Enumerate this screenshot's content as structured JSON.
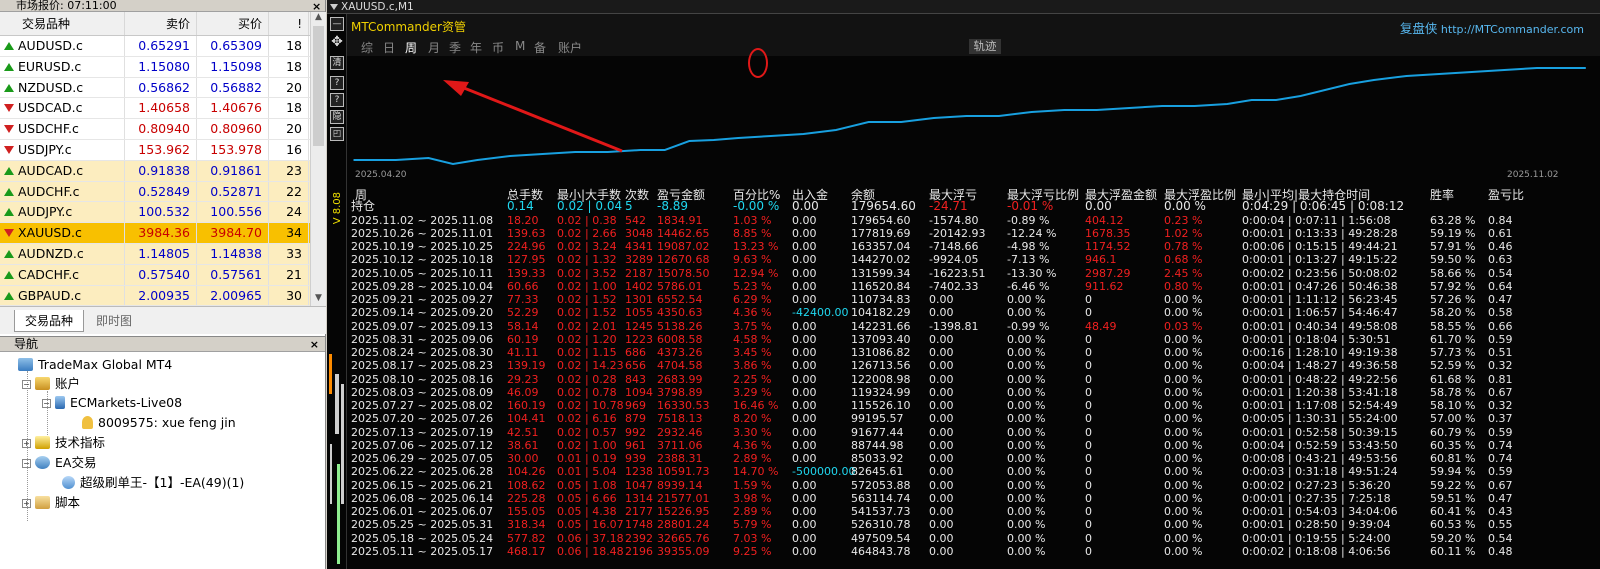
{
  "market_watch": {
    "title": "市场报价: 07:11:00",
    "headers": {
      "symbol": "交易品种",
      "bid": "卖价",
      "ask": "买价",
      "spread": "!"
    },
    "rows": [
      {
        "symbol": "AUDUSD.c",
        "bid": "0.65291",
        "ask": "0.65309",
        "spread": "18",
        "dir": "up",
        "style": ""
      },
      {
        "symbol": "EURUSD.c",
        "bid": "1.15080",
        "ask": "1.15098",
        "spread": "18",
        "dir": "up",
        "style": ""
      },
      {
        "symbol": "NZDUSD.c",
        "bid": "0.56862",
        "ask": "0.56882",
        "spread": "20",
        "dir": "up",
        "style": ""
      },
      {
        "symbol": "USDCAD.c",
        "bid": "1.40658",
        "ask": "1.40676",
        "spread": "18",
        "dir": "dn",
        "style": ""
      },
      {
        "symbol": "USDCHF.c",
        "bid": "0.80940",
        "ask": "0.80960",
        "spread": "20",
        "dir": "dn",
        "style": ""
      },
      {
        "symbol": "USDJPY.c",
        "bid": "153.962",
        "ask": "153.978",
        "spread": "16",
        "dir": "dn",
        "style": ""
      },
      {
        "symbol": "AUDCAD.c",
        "bid": "0.91838",
        "ask": "0.91861",
        "spread": "23",
        "dir": "up",
        "style": "hl"
      },
      {
        "symbol": "AUDCHF.c",
        "bid": "0.52849",
        "ask": "0.52871",
        "spread": "22",
        "dir": "up",
        "style": "hl"
      },
      {
        "symbol": "AUDJPY.c",
        "bid": "100.532",
        "ask": "100.556",
        "spread": "24",
        "dir": "up",
        "style": "hl"
      },
      {
        "symbol": "XAUUSD.c",
        "bid": "3984.36",
        "ask": "3984.70",
        "spread": "34",
        "dir": "dn",
        "style": "sel"
      },
      {
        "symbol": "AUDNZD.c",
        "bid": "1.14805",
        "ask": "1.14838",
        "spread": "33",
        "dir": "up",
        "style": "hl"
      },
      {
        "symbol": "CADCHF.c",
        "bid": "0.57540",
        "ask": "0.57561",
        "spread": "21",
        "dir": "up",
        "style": "hl"
      },
      {
        "symbol": "GBPAUD.c",
        "bid": "2.00935",
        "ask": "2.00965",
        "spread": "30",
        "dir": "up",
        "style": "hl"
      }
    ],
    "tabs": [
      "交易品种",
      "即时图"
    ],
    "close_glyph": "×"
  },
  "navigator": {
    "title": "导航",
    "close_glyph": "×",
    "terminal": "TradeMax Global MT4",
    "accounts": "账户",
    "server": "ECMarkets-Live08",
    "user": "8009575: xue feng jin",
    "indicators": "技术指标",
    "ea": "EA交易",
    "ea_item": "超级刷单王-【1】-EA(49)(1)",
    "scripts": "脚本"
  },
  "chart": {
    "window_title": "XAUUSD.c,M1",
    "side_tools": [
      "—",
      "✥",
      "清",
      "?",
      "?",
      "隐",
      "◰"
    ],
    "side_label": "V 8.08",
    "panel_title": "MTCommander资管",
    "link_cn": "复盘侠",
    "link_url": "http://MTCommander.com",
    "periods": [
      "综",
      "日",
      "周",
      "月",
      "季",
      "年",
      "币",
      "M",
      "备",
      "账户"
    ],
    "active_period": "周",
    "track_button": "轨迹",
    "date_start": "2025.04.20",
    "date_end": "2025.11.02",
    "curve_color": "#18a0e0",
    "annotation_color": "#e01818"
  },
  "table": {
    "headers": [
      "周",
      "总手数",
      "最小|大手数",
      "次数",
      "盈亏金额",
      "百分比%",
      "出入金",
      "余额",
      "最大浮亏",
      "最大浮亏比例",
      "最大浮盈金额",
      "最大浮盈比例",
      "最小|平均|最大持仓时间",
      "胜率",
      "盈亏比"
    ],
    "holding": {
      "label": "持仓",
      "lots": "0.14",
      "minmax": "0.02 | 0.04",
      "count": "5",
      "pnl": "-8.89",
      "pct": "-0.00 %",
      "io": "0.00",
      "balance": "179654.60",
      "maxloss": "-24.71",
      "maxloss_pct": "-0.01 %",
      "maxprofit": "0.00",
      "maxprofit_pct": "0.00 %",
      "time": "0:04:29 | 0:06:45 | 0:08:12",
      "winrate": "",
      "pf": ""
    },
    "rows": [
      {
        "period": "2025.11.02 ~ 2025.11.08",
        "lots": "18.20",
        "minmax": "0.02 | 0.38",
        "count": "542",
        "pnl": "1834.91",
        "pct": "1.03 %",
        "io": "0.00",
        "balance": "179654.60",
        "maxloss": "-1574.80",
        "maxloss_pct": "-0.89 %",
        "maxprofit": "404.12",
        "maxprofit_pct": "0.23 %",
        "time": "0:00:04 | 0:07:11 | 1:56:08",
        "winrate": "63.28 %",
        "pf": "0.84",
        "io_cyan": false
      },
      {
        "period": "2025.10.26 ~ 2025.11.01",
        "lots": "139.63",
        "minmax": "0.02 | 2.66",
        "count": "3048",
        "pnl": "14462.65",
        "pct": "8.85 %",
        "io": "0.00",
        "balance": "177819.69",
        "maxloss": "-20142.93",
        "maxloss_pct": "-12.24 %",
        "maxprofit": "1678.35",
        "maxprofit_pct": "1.02 %",
        "time": "0:00:01 | 0:13:33 | 49:28:28",
        "winrate": "59.19 %",
        "pf": "0.61",
        "io_cyan": false
      },
      {
        "period": "2025.10.19 ~ 2025.10.25",
        "lots": "224.96",
        "minmax": "0.02 | 3.24",
        "count": "4341",
        "pnl": "19087.02",
        "pct": "13.23 %",
        "io": "0.00",
        "balance": "163357.04",
        "maxloss": "-7148.66",
        "maxloss_pct": "-4.98 %",
        "maxprofit": "1174.52",
        "maxprofit_pct": "0.78 %",
        "time": "0:00:06 | 0:15:15 | 49:44:21",
        "winrate": "57.91 %",
        "pf": "0.46",
        "io_cyan": false
      },
      {
        "period": "2025.10.12 ~ 2025.10.18",
        "lots": "127.95",
        "minmax": "0.02 | 1.32",
        "count": "3289",
        "pnl": "12670.68",
        "pct": "9.63 %",
        "io": "0.00",
        "balance": "144270.02",
        "maxloss": "-9924.05",
        "maxloss_pct": "-7.13 %",
        "maxprofit": "946.1",
        "maxprofit_pct": "0.68 %",
        "time": "0:00:01 | 0:13:27 | 49:15:22",
        "winrate": "59.50 %",
        "pf": "0.63",
        "io_cyan": false
      },
      {
        "period": "2025.10.05 ~ 2025.10.11",
        "lots": "139.33",
        "minmax": "0.02 | 3.52",
        "count": "2187",
        "pnl": "15078.50",
        "pct": "12.94 %",
        "io": "0.00",
        "balance": "131599.34",
        "maxloss": "-16223.51",
        "maxloss_pct": "-13.30 %",
        "maxprofit": "2987.29",
        "maxprofit_pct": "2.45 %",
        "time": "0:00:02 | 0:23:56 | 50:08:02",
        "winrate": "58.66 %",
        "pf": "0.54",
        "io_cyan": false
      },
      {
        "period": "2025.09.28 ~ 2025.10.04",
        "lots": "60.66",
        "minmax": "0.02 | 1.00",
        "count": "1402",
        "pnl": "5786.01",
        "pct": "5.23 %",
        "io": "0.00",
        "balance": "116520.84",
        "maxloss": "-7402.33",
        "maxloss_pct": "-6.46 %",
        "maxprofit": "911.62",
        "maxprofit_pct": "0.80 %",
        "time": "0:00:01 | 0:47:26 | 50:46:38",
        "winrate": "57.92 %",
        "pf": "0.64",
        "io_cyan": false
      },
      {
        "period": "2025.09.21 ~ 2025.09.27",
        "lots": "77.33",
        "minmax": "0.02 | 1.52",
        "count": "1301",
        "pnl": "6552.54",
        "pct": "6.29 %",
        "io": "0.00",
        "balance": "110734.83",
        "maxloss": "0.00",
        "maxloss_pct": "0.00 %",
        "maxprofit": "0",
        "maxprofit_pct": "0.00 %",
        "time": "0:00:01 | 1:11:12 | 56:23:45",
        "winrate": "57.26 %",
        "pf": "0.47",
        "io_cyan": false
      },
      {
        "period": "2025.09.14 ~ 2025.09.20",
        "lots": "52.29",
        "minmax": "0.02 | 1.52",
        "count": "1055",
        "pnl": "4350.63",
        "pct": "4.36 %",
        "io": "-42400.00",
        "balance": "104182.29",
        "maxloss": "0.00",
        "maxloss_pct": "0.00 %",
        "maxprofit": "0",
        "maxprofit_pct": "0.00 %",
        "time": "0:00:01 | 1:06:57 | 54:46:47",
        "winrate": "58.20 %",
        "pf": "0.58",
        "io_cyan": true
      },
      {
        "period": "2025.09.07 ~ 2025.09.13",
        "lots": "58.14",
        "minmax": "0.02 | 2.01",
        "count": "1245",
        "pnl": "5138.26",
        "pct": "3.75 %",
        "io": "0.00",
        "balance": "142231.66",
        "maxloss": "-1398.81",
        "maxloss_pct": "-0.99 %",
        "maxprofit": "48.49",
        "maxprofit_pct": "0.03 %",
        "time": "0:00:01 | 0:40:34 | 49:58:08",
        "winrate": "58.55 %",
        "pf": "0.66",
        "io_cyan": false
      },
      {
        "period": "2025.08.31 ~ 2025.09.06",
        "lots": "60.19",
        "minmax": "0.02 | 1.20",
        "count": "1223",
        "pnl": "6008.58",
        "pct": "4.58 %",
        "io": "0.00",
        "balance": "137093.40",
        "maxloss": "0.00",
        "maxloss_pct": "0.00 %",
        "maxprofit": "0",
        "maxprofit_pct": "0.00 %",
        "time": "0:00:01 | 0:18:04 | 5:30:51",
        "winrate": "61.70 %",
        "pf": "0.59",
        "io_cyan": false
      },
      {
        "period": "2025.08.24 ~ 2025.08.30",
        "lots": "41.11",
        "minmax": "0.02 | 1.15",
        "count": "686",
        "pnl": "4373.26",
        "pct": "3.45 %",
        "io": "0.00",
        "balance": "131086.82",
        "maxloss": "0.00",
        "maxloss_pct": "0.00 %",
        "maxprofit": "0",
        "maxprofit_pct": "0.00 %",
        "time": "0:00:16 | 1:28:10 | 49:19:38",
        "winrate": "57.73 %",
        "pf": "0.51",
        "io_cyan": false
      },
      {
        "period": "2025.08.17 ~ 2025.08.23",
        "lots": "139.19",
        "minmax": "0.02 | 14.23",
        "count": "656",
        "pnl": "4704.58",
        "pct": "3.86 %",
        "io": "0.00",
        "balance": "126713.56",
        "maxloss": "0.00",
        "maxloss_pct": "0.00 %",
        "maxprofit": "0",
        "maxprofit_pct": "0.00 %",
        "time": "0:00:04 | 1:48:27 | 49:36:58",
        "winrate": "52.59 %",
        "pf": "0.32",
        "io_cyan": false
      },
      {
        "period": "2025.08.10 ~ 2025.08.16",
        "lots": "29.23",
        "minmax": "0.02 | 0.28",
        "count": "843",
        "pnl": "2683.99",
        "pct": "2.25 %",
        "io": "0.00",
        "balance": "122008.98",
        "maxloss": "0.00",
        "maxloss_pct": "0.00 %",
        "maxprofit": "0",
        "maxprofit_pct": "0.00 %",
        "time": "0:00:01 | 0:48:22 | 49:22:56",
        "winrate": "61.68 %",
        "pf": "0.81",
        "io_cyan": false
      },
      {
        "period": "2025.08.03 ~ 2025.08.09",
        "lots": "46.09",
        "minmax": "0.02 | 0.78",
        "count": "1094",
        "pnl": "3798.89",
        "pct": "3.29 %",
        "io": "0.00",
        "balance": "119324.99",
        "maxloss": "0.00",
        "maxloss_pct": "0.00 %",
        "maxprofit": "0",
        "maxprofit_pct": "0.00 %",
        "time": "0:00:01 | 1:20:38 | 53:41:18",
        "winrate": "58.78 %",
        "pf": "0.67",
        "io_cyan": false
      },
      {
        "period": "2025.07.27 ~ 2025.08.02",
        "lots": "160.19",
        "minmax": "0.02 | 10.78",
        "count": "969",
        "pnl": "16330.53",
        "pct": "16.46 %",
        "io": "0.00",
        "balance": "115526.10",
        "maxloss": "0.00",
        "maxloss_pct": "0.00 %",
        "maxprofit": "0",
        "maxprofit_pct": "0.00 %",
        "time": "0:00:01 | 1:17:08 | 52:54:49",
        "winrate": "58.10 %",
        "pf": "0.32",
        "io_cyan": false
      },
      {
        "period": "2025.07.20 ~ 2025.07.26",
        "lots": "104.41",
        "minmax": "0.02 | 6.16",
        "count": "879",
        "pnl": "7518.13",
        "pct": "8.20 %",
        "io": "0.00",
        "balance": "99195.57",
        "maxloss": "0.00",
        "maxloss_pct": "0.00 %",
        "maxprofit": "0",
        "maxprofit_pct": "0.00 %",
        "time": "0:00:05 | 1:30:31 | 55:24:00",
        "winrate": "57.00 %",
        "pf": "0.37",
        "io_cyan": false
      },
      {
        "period": "2025.07.13 ~ 2025.07.19",
        "lots": "42.51",
        "minmax": "0.02 | 0.57",
        "count": "992",
        "pnl": "2932.46",
        "pct": "3.30 %",
        "io": "0.00",
        "balance": "91677.44",
        "maxloss": "0.00",
        "maxloss_pct": "0.00 %",
        "maxprofit": "0",
        "maxprofit_pct": "0.00 %",
        "time": "0:00:01 | 0:52:58 | 50:39:15",
        "winrate": "60.79 %",
        "pf": "0.59",
        "io_cyan": false
      },
      {
        "period": "2025.07.06 ~ 2025.07.12",
        "lots": "38.61",
        "minmax": "0.02 | 1.00",
        "count": "961",
        "pnl": "3711.06",
        "pct": "4.36 %",
        "io": "0.00",
        "balance": "88744.98",
        "maxloss": "0.00",
        "maxloss_pct": "0.00 %",
        "maxprofit": "0",
        "maxprofit_pct": "0.00 %",
        "time": "0:00:04 | 0:52:59 | 53:43:50",
        "winrate": "60.35 %",
        "pf": "0.74",
        "io_cyan": false
      },
      {
        "period": "2025.06.29 ~ 2025.07.05",
        "lots": "30.00",
        "minmax": "0.01 | 0.19",
        "count": "939",
        "pnl": "2388.31",
        "pct": "2.89 %",
        "io": "0.00",
        "balance": "85033.92",
        "maxloss": "0.00",
        "maxloss_pct": "0.00 %",
        "maxprofit": "0",
        "maxprofit_pct": "0.00 %",
        "time": "0:00:08 | 0:43:21 | 49:53:56",
        "winrate": "60.81 %",
        "pf": "0.74",
        "io_cyan": false
      },
      {
        "period": "2025.06.22 ~ 2025.06.28",
        "lots": "104.26",
        "minmax": "0.01 | 5.04",
        "count": "1238",
        "pnl": "10591.73",
        "pct": "14.70 %",
        "io": "-500000.00",
        "balance": "82645.61",
        "maxloss": "0.00",
        "maxloss_pct": "0.00 %",
        "maxprofit": "0",
        "maxprofit_pct": "0.00 %",
        "time": "0:00:03 | 0:31:18 | 49:51:24",
        "winrate": "59.94 %",
        "pf": "0.59",
        "io_cyan": true
      },
      {
        "period": "2025.06.15 ~ 2025.06.21",
        "lots": "108.62",
        "minmax": "0.05 | 1.08",
        "count": "1047",
        "pnl": "8939.14",
        "pct": "1.59 %",
        "io": "0.00",
        "balance": "572053.88",
        "maxloss": "0.00",
        "maxloss_pct": "0.00 %",
        "maxprofit": "0",
        "maxprofit_pct": "0.00 %",
        "time": "0:00:02 | 0:27:23 | 5:36:20",
        "winrate": "59.22 %",
        "pf": "0.67",
        "io_cyan": false
      },
      {
        "period": "2025.06.08 ~ 2025.06.14",
        "lots": "225.28",
        "minmax": "0.05 | 6.66",
        "count": "1314",
        "pnl": "21577.01",
        "pct": "3.98 %",
        "io": "0.00",
        "balance": "563114.74",
        "maxloss": "0.00",
        "maxloss_pct": "0.00 %",
        "maxprofit": "0",
        "maxprofit_pct": "0.00 %",
        "time": "0:00:01 | 0:27:35 | 7:25:18",
        "winrate": "59.51 %",
        "pf": "0.47",
        "io_cyan": false
      },
      {
        "period": "2025.06.01 ~ 2025.06.07",
        "lots": "155.05",
        "minmax": "0.05 | 4.38",
        "count": "2177",
        "pnl": "15226.95",
        "pct": "2.89 %",
        "io": "0.00",
        "balance": "541537.73",
        "maxloss": "0.00",
        "maxloss_pct": "0.00 %",
        "maxprofit": "0",
        "maxprofit_pct": "0.00 %",
        "time": "0:00:01 | 0:54:03 | 34:04:06",
        "winrate": "60.41 %",
        "pf": "0.43",
        "io_cyan": false
      },
      {
        "period": "2025.05.25 ~ 2025.05.31",
        "lots": "318.34",
        "minmax": "0.05 | 16.07",
        "count": "1748",
        "pnl": "28801.24",
        "pct": "5.79 %",
        "io": "0.00",
        "balance": "526310.78",
        "maxloss": "0.00",
        "maxloss_pct": "0.00 %",
        "maxprofit": "0",
        "maxprofit_pct": "0.00 %",
        "time": "0:00:01 | 0:28:50 | 9:39:04",
        "winrate": "60.53 %",
        "pf": "0.55",
        "io_cyan": false
      },
      {
        "period": "2025.05.18 ~ 2025.05.24",
        "lots": "577.82",
        "minmax": "0.06 | 37.18",
        "count": "2392",
        "pnl": "32665.76",
        "pct": "7.03 %",
        "io": "0.00",
        "balance": "497509.54",
        "maxloss": "0.00",
        "maxloss_pct": "0.00 %",
        "maxprofit": "0",
        "maxprofit_pct": "0.00 %",
        "time": "0:00:01 | 0:19:55 | 5:24:00",
        "winrate": "59.20 %",
        "pf": "0.54",
        "io_cyan": false
      },
      {
        "period": "2025.05.11 ~ 2025.05.17",
        "lots": "468.17",
        "minmax": "0.06 | 18.48",
        "count": "2196",
        "pnl": "39355.09",
        "pct": "9.25 %",
        "io": "0.00",
        "balance": "464843.78",
        "maxloss": "0.00",
        "maxloss_pct": "0.00 %",
        "maxprofit": "0",
        "maxprofit_pct": "0.00 %",
        "time": "0:00:02 | 0:18:08 | 4:06:56",
        "winrate": "60.11 %",
        "pf": "0.48",
        "io_cyan": false
      }
    ]
  }
}
